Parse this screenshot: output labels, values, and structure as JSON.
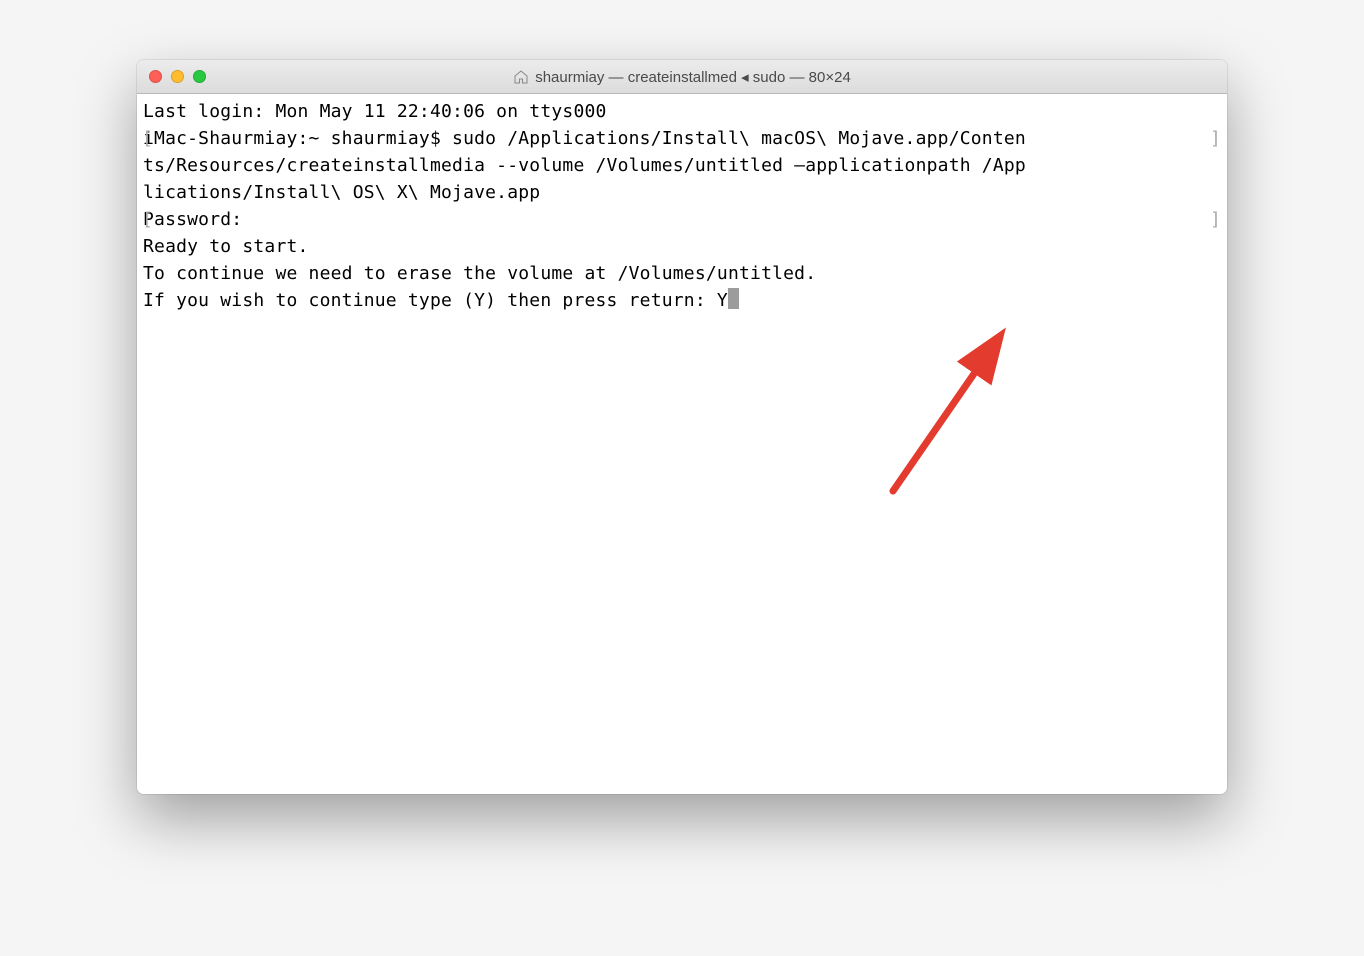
{
  "window": {
    "title": "shaurmiay — createinstallmed ◂ sudo — 80×24"
  },
  "terminal": {
    "line1": "Last login: Mon May 11 22:40:06 on ttys000",
    "line2": "iMac-Shaurmiay:~ shaurmiay$ sudo /Applications/Install\\ macOS\\ Mojave.app/Conten",
    "line3": "ts/Resources/createinstallmedia --volume /Volumes/untitled —applicationpath /App",
    "line4": "lications/Install\\ OS\\ X\\ Mojave.app",
    "line5": "Password:",
    "line6": "Ready to start.",
    "line7": "To continue we need to erase the volume at /Volumes/untitled.",
    "line8_prompt": "If you wish to continue type (Y) then press return: ",
    "line8_input": "Y"
  }
}
